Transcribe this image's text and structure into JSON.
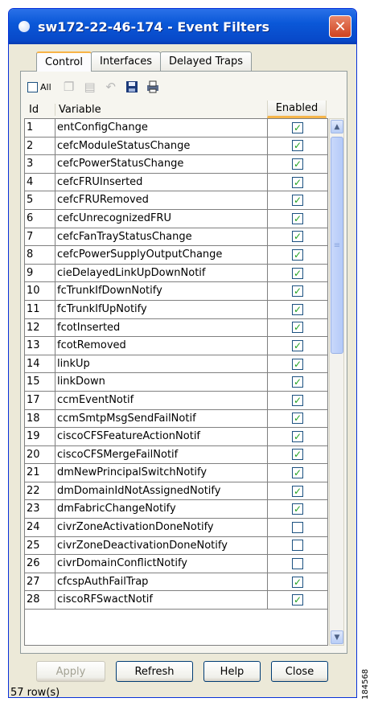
{
  "window": {
    "title": "sw172-22-46-174 - Event Filters",
    "close_symbol": "✕"
  },
  "tabs": [
    {
      "label": "Control",
      "active": true
    },
    {
      "label": "Interfaces",
      "active": false
    },
    {
      "label": "Delayed Traps",
      "active": false
    }
  ],
  "toolbar": {
    "all_label": "All",
    "icons": [
      "copy-icon",
      "paste-icon",
      "undo-icon",
      "save-icon",
      "print-icon"
    ]
  },
  "grid": {
    "columns": {
      "id": "Id",
      "variable": "Variable",
      "enabled": "Enabled"
    },
    "rows": [
      {
        "id": "1",
        "variable": "entConfigChange",
        "enabled": true
      },
      {
        "id": "2",
        "variable": "cefcModuleStatusChange",
        "enabled": true
      },
      {
        "id": "3",
        "variable": "cefcPowerStatusChange",
        "enabled": true
      },
      {
        "id": "4",
        "variable": "cefcFRUInserted",
        "enabled": true
      },
      {
        "id": "5",
        "variable": "cefcFRURemoved",
        "enabled": true
      },
      {
        "id": "6",
        "variable": "cefcUnrecognizedFRU",
        "enabled": true
      },
      {
        "id": "7",
        "variable": "cefcFanTrayStatusChange",
        "enabled": true
      },
      {
        "id": "8",
        "variable": "cefcPowerSupplyOutputChange",
        "enabled": true
      },
      {
        "id": "9",
        "variable": "cieDelayedLinkUpDownNotif",
        "enabled": true
      },
      {
        "id": "10",
        "variable": "fcTrunkIfDownNotify",
        "enabled": true
      },
      {
        "id": "11",
        "variable": "fcTrunkIfUpNotify",
        "enabled": true
      },
      {
        "id": "12",
        "variable": "fcotInserted",
        "enabled": true
      },
      {
        "id": "13",
        "variable": "fcotRemoved",
        "enabled": true
      },
      {
        "id": "14",
        "variable": "linkUp",
        "enabled": true
      },
      {
        "id": "15",
        "variable": "linkDown",
        "enabled": true
      },
      {
        "id": "17",
        "variable": "ccmEventNotif",
        "enabled": true
      },
      {
        "id": "18",
        "variable": "ccmSmtpMsgSendFailNotif",
        "enabled": true
      },
      {
        "id": "19",
        "variable": "ciscoCFSFeatureActionNotif",
        "enabled": true
      },
      {
        "id": "20",
        "variable": "ciscoCFSMergeFailNotif",
        "enabled": true
      },
      {
        "id": "21",
        "variable": "dmNewPrincipalSwitchNotify",
        "enabled": true
      },
      {
        "id": "22",
        "variable": "dmDomainIdNotAssignedNotify",
        "enabled": true
      },
      {
        "id": "23",
        "variable": "dmFabricChangeNotify",
        "enabled": true
      },
      {
        "id": "24",
        "variable": "civrZoneActivationDoneNotify",
        "enabled": false
      },
      {
        "id": "25",
        "variable": "civrZoneDeactivationDoneNotify",
        "enabled": false
      },
      {
        "id": "26",
        "variable": "civrDomainConflictNotify",
        "enabled": false
      },
      {
        "id": "27",
        "variable": "cfcspAuthFailTrap",
        "enabled": true
      },
      {
        "id": "28",
        "variable": "ciscoRFSwactNotif",
        "enabled": true
      }
    ]
  },
  "buttons": [
    {
      "label": "Apply",
      "enabled": false
    },
    {
      "label": "Refresh",
      "enabled": true
    },
    {
      "label": "Help",
      "enabled": true
    },
    {
      "label": "Close",
      "enabled": true
    }
  ],
  "status": {
    "row_count": "57 row(s)"
  },
  "side_tag": "184568",
  "colors": {
    "titlebar": "#0a58d8",
    "accent_tab": "#f7b347",
    "check": "#21a121"
  }
}
